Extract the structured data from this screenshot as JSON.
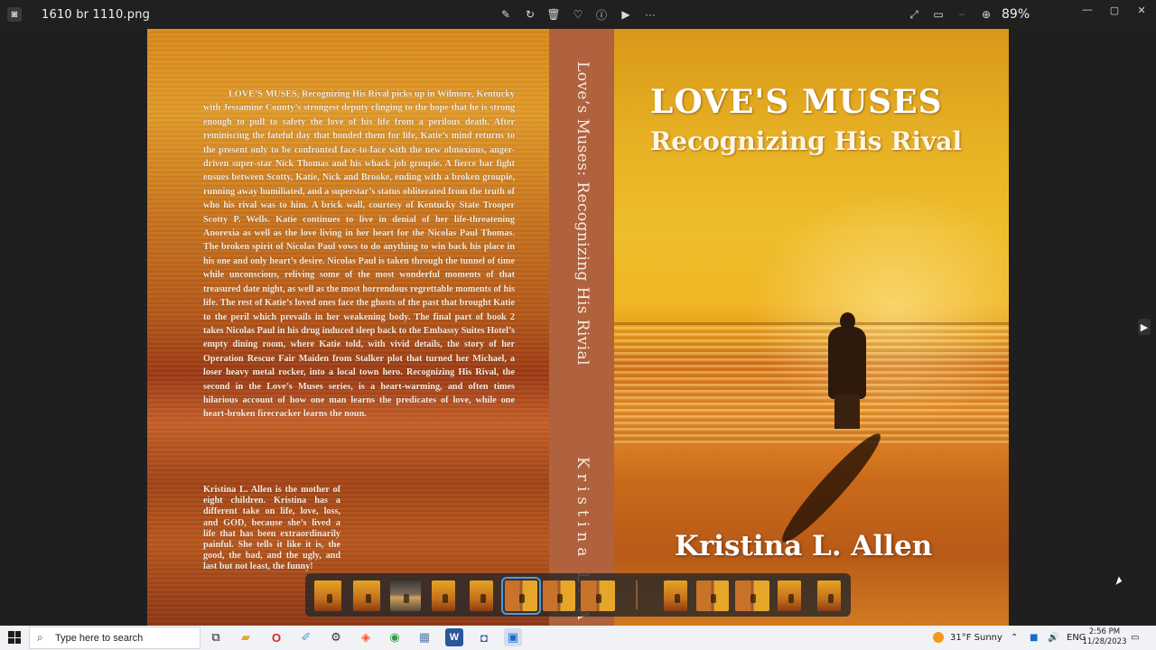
{
  "window": {
    "file_name": "1610  br  1110.png",
    "zoom": "89%",
    "toolbar_icons": [
      "edit-icon",
      "rotate-icon",
      "delete-icon",
      "favorite-icon",
      "info-icon",
      "slideshow-icon",
      "more-icon"
    ],
    "right_icons": [
      "fullscreen-icon",
      "fit-icon",
      "zoom-out-icon",
      "zoom-in-icon"
    ],
    "controls": {
      "minimize": "—",
      "maximize": "▢",
      "close": "✕"
    }
  },
  "cover": {
    "front_title": "LOVE'S MUSES",
    "front_subtitle": "Recognizing His Rival",
    "front_author": "Kristina L. Allen",
    "spine_title": "Love’s Muses: Recognizing His Rivial",
    "spine_author": "Kristina L. A",
    "blurb": "LOVE’S MUSES, Recognizing His Rival picks up in Wilmore, Kentucky with Jessamine County’s strongest deputy clinging to the hope that he is strong enough to pull to safety the love of his life from a perilous death. After reminiscing the fateful day that bonded them for life, Katie’s mind returns to the present only to be confronted face-to-face with the new obnoxious, anger-driven super-star Nick Thomas and his whack job groupie. A fierce bar fight ensues between Scotty, Katie, Nick and Brooke, ending with a broken groupie, running away humiliated, and a superstar’s status obliterated from the truth of who his rival was to him. A brick wall, courtesy of Kentucky State Trooper Scotty P. Wells. Katie continues to live in denial of her life-threatening Anorexia as well as the love living in her heart for the Nicolas Paul Thomas. The broken spirit of Nicolas Paul vows to do anything to win back his place in his one and only heart’s desire. Nicolas Paul is taken through the tunnel of time while unconscious, reliving some of the most wonderful moments of that treasured date night, as well as the most horrendous regrettable moments of his life. The rest of Katie’s loved ones face the ghosts of the past that brought Katie to the peril which prevails in her weakening body. The final part of book 2 takes Nicolas Paul in his drug induced sleep back to the Embassy Suites Hotel’s empty dining room, where Katie told, with vivid details, the story of her Operation Rescue Fair Maiden from Stalker plot that turned her Michael, a loser heavy metal rocker, into a local town hero. Recognizing His Rival, the second in the Love’s Muses series, is a heart-warming, and often times hilarious account of how one man learns the predicates of love, while one heart-broken firecracker learns the noun.",
    "bio": "Kristina L. Allen is the mother of eight children. Kristina has a different take on life, love, loss, and GOD, because she’s lived a life that has been extraordinarily painful. She tells it like it is, the good, the bad, and the ugly, and last but not least, the funny!"
  },
  "viewer": {
    "next_icon": "▶",
    "filmstrip_selected_index": 5,
    "thumbnails": [
      "cover",
      "cover",
      "sunset",
      "cover",
      "cover",
      "wide",
      "wide",
      "wide",
      "cover",
      "wide",
      "wide",
      "cover",
      "cover"
    ]
  },
  "taskbar": {
    "search_placeholder": "Type here to search",
    "apps": [
      "task-view-icon",
      "file-explorer-icon",
      "opera-icon",
      "paint-icon",
      "settings-icon",
      "brave-icon",
      "chrome-icon",
      "photos-gallery-icon",
      "word-icon",
      "camera-icon",
      "photos-icon"
    ],
    "weather": "31°F  Sunny",
    "language": "ENG",
    "time": "2:56 PM",
    "date": "11/28/2023"
  },
  "colors": {
    "selection_accent": "#4e9bd9",
    "spine": "#b0613d",
    "weather": "#f29a1e"
  }
}
